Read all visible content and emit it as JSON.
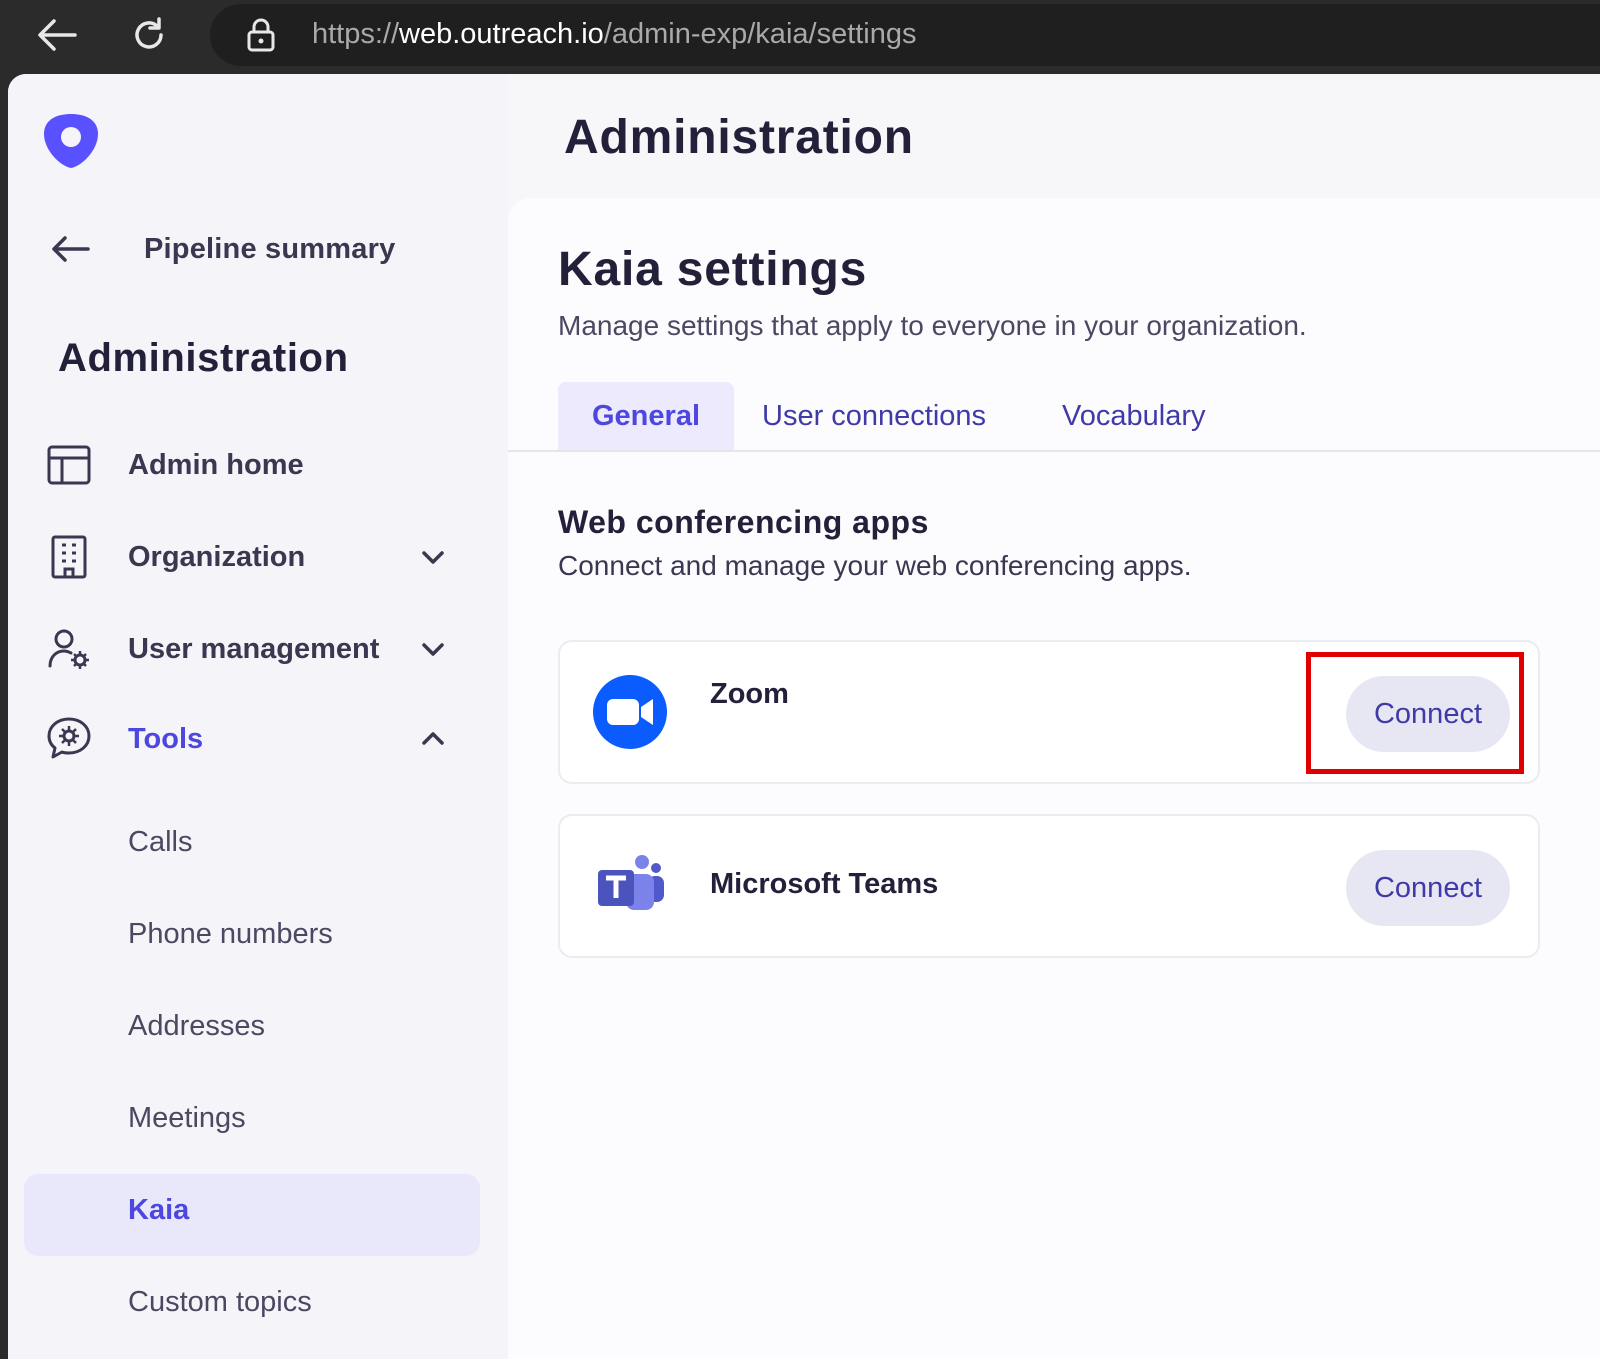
{
  "browser": {
    "url_prefix": "https://",
    "url_host": "web.outreach.io",
    "url_path": "/admin-exp/kaia/settings"
  },
  "sidebar": {
    "back_label": "Pipeline summary",
    "title": "Administration",
    "items": [
      {
        "label": "Admin home",
        "icon": "layout-icon"
      },
      {
        "label": "Organization",
        "icon": "building-icon",
        "chevron": "down"
      },
      {
        "label": "User management",
        "icon": "user-gear-icon",
        "chevron": "down"
      },
      {
        "label": "Tools",
        "icon": "tools-icon",
        "chevron": "up",
        "active": true
      }
    ],
    "tools_children": [
      {
        "label": "Calls"
      },
      {
        "label": "Phone numbers"
      },
      {
        "label": "Addresses"
      },
      {
        "label": "Meetings"
      },
      {
        "label": "Kaia",
        "selected": true
      },
      {
        "label": "Custom topics"
      }
    ]
  },
  "main": {
    "title": "Administration",
    "panel_title": "Kaia settings",
    "panel_subtitle": "Manage settings that apply to everyone in your organization.",
    "tabs": [
      {
        "label": "General",
        "active": true
      },
      {
        "label": "User connections"
      },
      {
        "label": "Vocabulary"
      }
    ],
    "section_title": "Web conferencing apps",
    "section_subtitle": "Connect and manage your web conferencing apps.",
    "apps": [
      {
        "name": "Zoom",
        "button": "Connect",
        "icon": "zoom-icon"
      },
      {
        "name": "Microsoft Teams",
        "button": "Connect",
        "icon": "teams-icon"
      }
    ]
  },
  "colors": {
    "accent": "#4d47e0",
    "highlight": "#e00000",
    "zoom": "#0b5cff",
    "teams": "#5b5fc7"
  }
}
